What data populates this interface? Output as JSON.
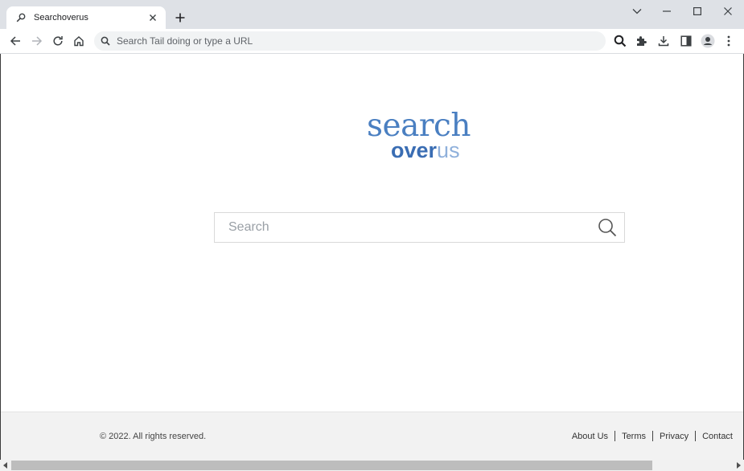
{
  "browser": {
    "tab": {
      "title": "Searchoverus"
    },
    "omnibox": {
      "placeholder": "Search Tail doing or type a URL"
    }
  },
  "page": {
    "logo": {
      "top": "search",
      "bottom_bold": "over",
      "bottom_light": "us"
    },
    "search": {
      "placeholder": "Search"
    },
    "footer": {
      "copyright": "© 2022. All rights reserved.",
      "links": [
        "About Us",
        "Terms",
        "Privacy",
        "Contact"
      ]
    }
  },
  "colors": {
    "brand_blue": "#4a7fc1",
    "brand_light": "#8fb0db",
    "chrome_bg": "#dee1e6"
  }
}
